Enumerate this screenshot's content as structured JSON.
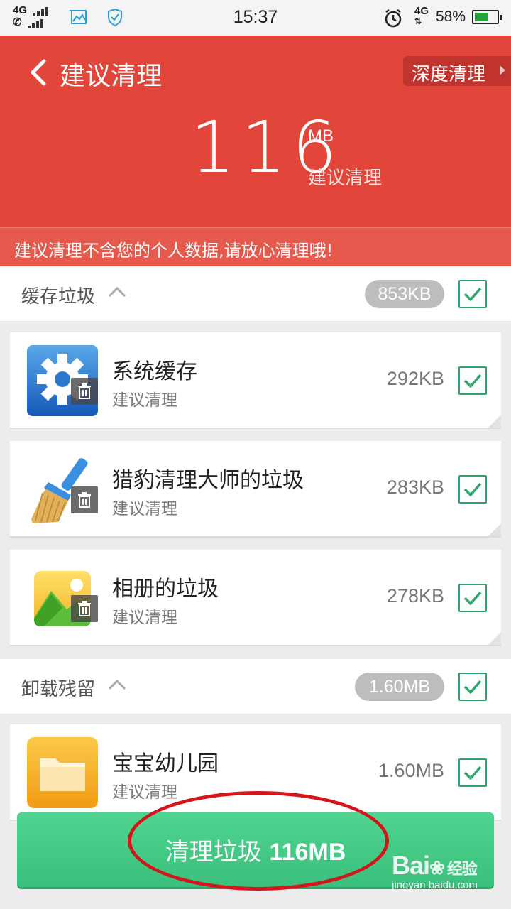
{
  "status_bar": {
    "network_sim1": "4G",
    "time": "15:37",
    "network_right": "4G",
    "battery_percent": "58%",
    "battery_level": 0.58
  },
  "header": {
    "title": "建议清理",
    "deep_clean_label": "深度清理",
    "total_number": "116",
    "total_unit": "MB",
    "total_label": "建议清理",
    "notice": "建议清理不含您的个人数据,请放心清理哦!"
  },
  "sections": [
    {
      "label": "缓存垃圾",
      "size": "853KB",
      "checked": true,
      "items": [
        {
          "name": "系统缓存",
          "sub": "建议清理",
          "size": "292KB",
          "icon": "settings-gear-icon",
          "checked": true
        },
        {
          "name": "猎豹清理大师的垃圾",
          "sub": "建议清理",
          "size": "283KB",
          "icon": "broom-icon",
          "checked": true
        },
        {
          "name": "相册的垃圾",
          "sub": "建议清理",
          "size": "278KB",
          "icon": "gallery-icon",
          "checked": true
        }
      ]
    },
    {
      "label": "卸载残留",
      "size": "1.60MB",
      "checked": true,
      "items": [
        {
          "name": "宝宝幼儿园",
          "sub": "建议清理",
          "size": "1.60MB",
          "icon": "folder-icon",
          "checked": true
        }
      ]
    }
  ],
  "clean_button": {
    "label": "清理垃圾",
    "amount": "116MB"
  },
  "watermark": {
    "logo": "Bai",
    "logo_suffix": "经验",
    "url": "jingyan.baidu.com"
  },
  "colors": {
    "header_red": "#e2463b",
    "accent_green": "#2fa66e",
    "button_green": "#3bbf7c",
    "annotation_red": "#d4151c"
  }
}
